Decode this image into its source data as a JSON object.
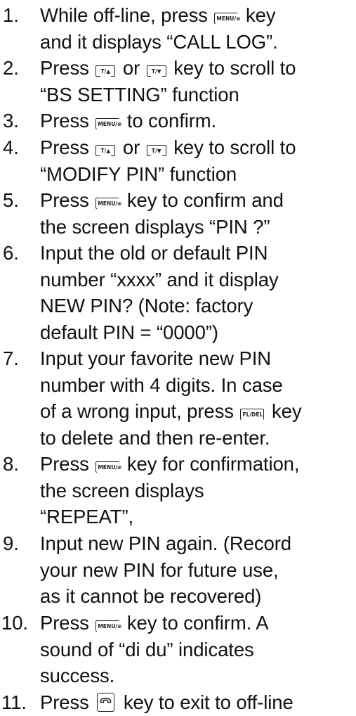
{
  "steps": [
    {
      "num": "1.",
      "lines": [
        [
          "While off-line, press ",
          "MENU/⊗",
          " key"
        ],
        [
          "and it displays “CALL LOG”."
        ]
      ]
    },
    {
      "num": "2.",
      "lines": [
        [
          "Press ",
          "T/▲",
          " or ",
          "T/▼",
          " key to scroll to"
        ],
        [
          "“BS SETTING” function"
        ]
      ]
    },
    {
      "num": "3.",
      "lines": [
        [
          "Press ",
          "MENU/⊗",
          " to confirm."
        ]
      ]
    },
    {
      "num": "4.",
      "lines": [
        [
          "Press ",
          "T/▲",
          " or ",
          "T/▼",
          " key to scroll to"
        ],
        [
          "“MODIFY PIN” function"
        ]
      ]
    },
    {
      "num": "5.",
      "lines": [
        [
          "Press ",
          "MENU/⊗",
          " key to confirm and"
        ],
        [
          "the screen displays “PIN ?”"
        ]
      ]
    },
    {
      "num": "6.",
      "lines": [
        [
          "Input the old or default PIN"
        ],
        [
          "number “xxxx” and it display"
        ],
        [
          "NEW PIN? (Note:  factory"
        ],
        [
          "default PIN = “0000”)"
        ]
      ]
    },
    {
      "num": "7.",
      "lines": [
        [
          "Input your favorite new PIN"
        ],
        [
          "number with 4 digits.  In case"
        ],
        [
          "of a wrong input, press ",
          "FL/DEL",
          " key"
        ],
        [
          "to delete and then re-enter."
        ]
      ]
    },
    {
      "num": "8.",
      "lines": [
        [
          "Press ",
          "MENU/⊗",
          " key for confirmation,"
        ],
        [
          "the screen displays"
        ],
        [
          "“REPEAT”,"
        ]
      ]
    },
    {
      "num": "9.",
      "lines": [
        [
          "Input new PIN again.  (Record"
        ],
        [
          "your new PIN for future use,"
        ],
        [
          "as it cannot be recovered)"
        ]
      ]
    },
    {
      "num": "10.",
      "lines": [
        [
          "Press ",
          "MENU/⊗",
          " key to confirm.  A"
        ],
        [
          "sound of “di du” indicates"
        ],
        [
          "success."
        ]
      ]
    },
    {
      "num": "11.",
      "lines": [
        [
          "Press ",
          "PHONE",
          " key to exit to off-line"
        ]
      ]
    }
  ],
  "keys": {
    "menu": "MENU/⊗",
    "up": "T/▲",
    "down": "T/▼",
    "fl": "FL/DEL",
    "phone": "PHONE"
  }
}
